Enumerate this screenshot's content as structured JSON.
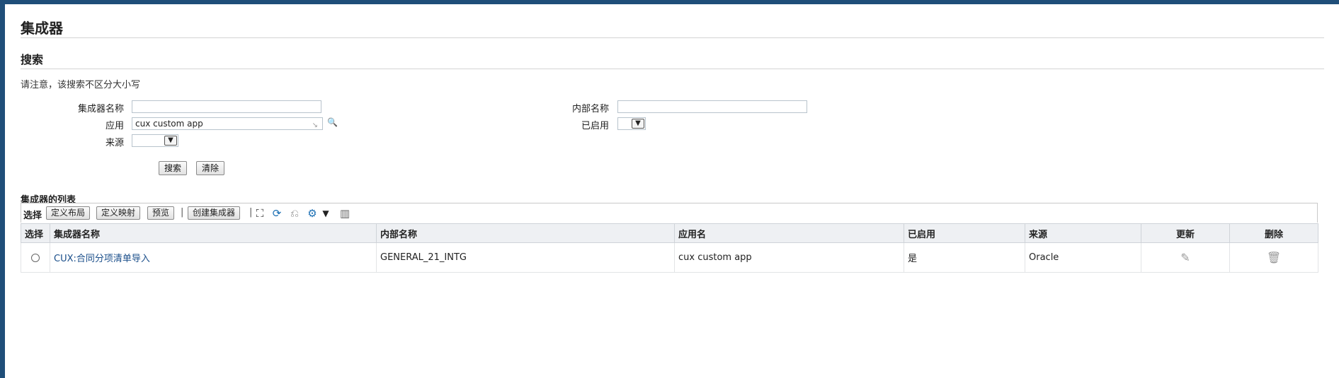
{
  "page": {
    "title": "集成器",
    "search_section_title": "搜索",
    "search_note": "请注意，该搜索不区分大小写"
  },
  "search_form": {
    "integrator_name": {
      "label": "集成器名称",
      "value": ""
    },
    "application": {
      "label": "应用",
      "value": "cux custom app"
    },
    "source": {
      "label": "来源",
      "value": ""
    },
    "internal_name": {
      "label": "内部名称",
      "value": ""
    },
    "enabled": {
      "label": "已启用",
      "value": ""
    },
    "search_button": "搜索",
    "clear_button": "清除"
  },
  "list": {
    "title": "集成器的列表",
    "toolbar": {
      "select_label": "选择",
      "buttons": [
        "定义布局",
        "定义映射",
        "预览"
      ],
      "separator": "|",
      "create_button": "创建集成器",
      "icons": [
        "detach-icon",
        "refresh-icon",
        "revert-icon",
        "gear-icon",
        "dropdown-arrow-icon",
        "columns-icon"
      ]
    },
    "columns": [
      "选择",
      "集成器名称",
      "内部名称",
      "应用名",
      "已启用",
      "来源",
      "更新",
      "删除"
    ],
    "rows": [
      {
        "integrator_name": "CUX:合同分项清单导入",
        "internal_name": "GENERAL_21_INTG",
        "application": "cux custom app",
        "enabled": "是",
        "source": "Oracle"
      }
    ]
  }
}
